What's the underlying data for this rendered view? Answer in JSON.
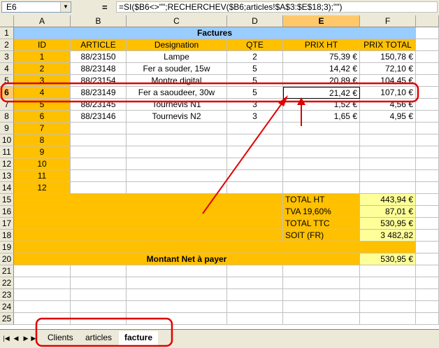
{
  "formula_bar": {
    "cell_ref": "E6",
    "fx": "=",
    "formula": "=SI($B6<>\"\";RECHERCHEV($B6;articles!$A$3:$E$18;3);\"\")"
  },
  "columns": [
    "A",
    "B",
    "C",
    "D",
    "E",
    "F"
  ],
  "selected_column": "E",
  "selected_row": "6",
  "title": "Factures",
  "headers": [
    "ID",
    "ARTICLE",
    "Designation",
    "QTE",
    "PRIX HT",
    "PRIX TOTAL"
  ],
  "items": [
    {
      "id": "1",
      "article": "88/23150",
      "designation": "Lampe",
      "qte": "2",
      "prix_ht": "75,39 €",
      "prix_total": "150,78 €"
    },
    {
      "id": "2",
      "article": "88/23148",
      "designation": "Fer a souder, 15w",
      "qte": "5",
      "prix_ht": "14,42 €",
      "prix_total": "72,10 €"
    },
    {
      "id": "3",
      "article": "88/23154",
      "designation": "Montre digital",
      "qte": "5",
      "prix_ht": "20,89 €",
      "prix_total": "104,45 €"
    },
    {
      "id": "4",
      "article": "88/23149",
      "designation": "Fer a saoudeer, 30w",
      "qte": "5",
      "prix_ht": "21,42 €",
      "prix_total": "107,10 €"
    },
    {
      "id": "5",
      "article": "88/23145",
      "designation": "Tournevis N1",
      "qte": "3",
      "prix_ht": "1,52 €",
      "prix_total": "4,56 €"
    },
    {
      "id": "6",
      "article": "88/23146",
      "designation": "Tournevis N2",
      "qte": "3",
      "prix_ht": "1,65 €",
      "prix_total": "4,95 €"
    },
    {
      "id": "7",
      "article": "",
      "designation": "",
      "qte": "",
      "prix_ht": "",
      "prix_total": ""
    },
    {
      "id": "8",
      "article": "",
      "designation": "",
      "qte": "",
      "prix_ht": "",
      "prix_total": ""
    },
    {
      "id": "9",
      "article": "",
      "designation": "",
      "qte": "",
      "prix_ht": "",
      "prix_total": ""
    },
    {
      "id": "10",
      "article": "",
      "designation": "",
      "qte": "",
      "prix_ht": "",
      "prix_total": ""
    },
    {
      "id": "11",
      "article": "",
      "designation": "",
      "qte": "",
      "prix_ht": "",
      "prix_total": ""
    },
    {
      "id": "12",
      "article": "",
      "designation": "",
      "qte": "",
      "prix_ht": "",
      "prix_total": ""
    }
  ],
  "totals": [
    {
      "label": "TOTAL HT",
      "value": "443,94 €"
    },
    {
      "label": "TVA 19,60%",
      "value": "87,01 €"
    },
    {
      "label": "TOTAL TTC",
      "value": "530,95 €"
    },
    {
      "label": "SOIT (FR)",
      "value": "3 482,82"
    }
  ],
  "net_label": "Montant Net à payer",
  "net_value": "530,95 €",
  "row_numbers": [
    "1",
    "2",
    "3",
    "4",
    "5",
    "6",
    "7",
    "8",
    "9",
    "10",
    "11",
    "12",
    "13",
    "14",
    "15",
    "16",
    "17",
    "18",
    "19",
    "20",
    "21",
    "22",
    "23",
    "24",
    "25"
  ],
  "sheet_tabs": [
    {
      "label": "Clients",
      "active": false
    },
    {
      "label": "articles",
      "active": false
    },
    {
      "label": "facture",
      "active": true
    }
  ],
  "colors": {
    "header_blue": "#99ccff",
    "orange": "#ffc000",
    "yellow": "#ffff99",
    "annotation_red": "#e00000"
  }
}
